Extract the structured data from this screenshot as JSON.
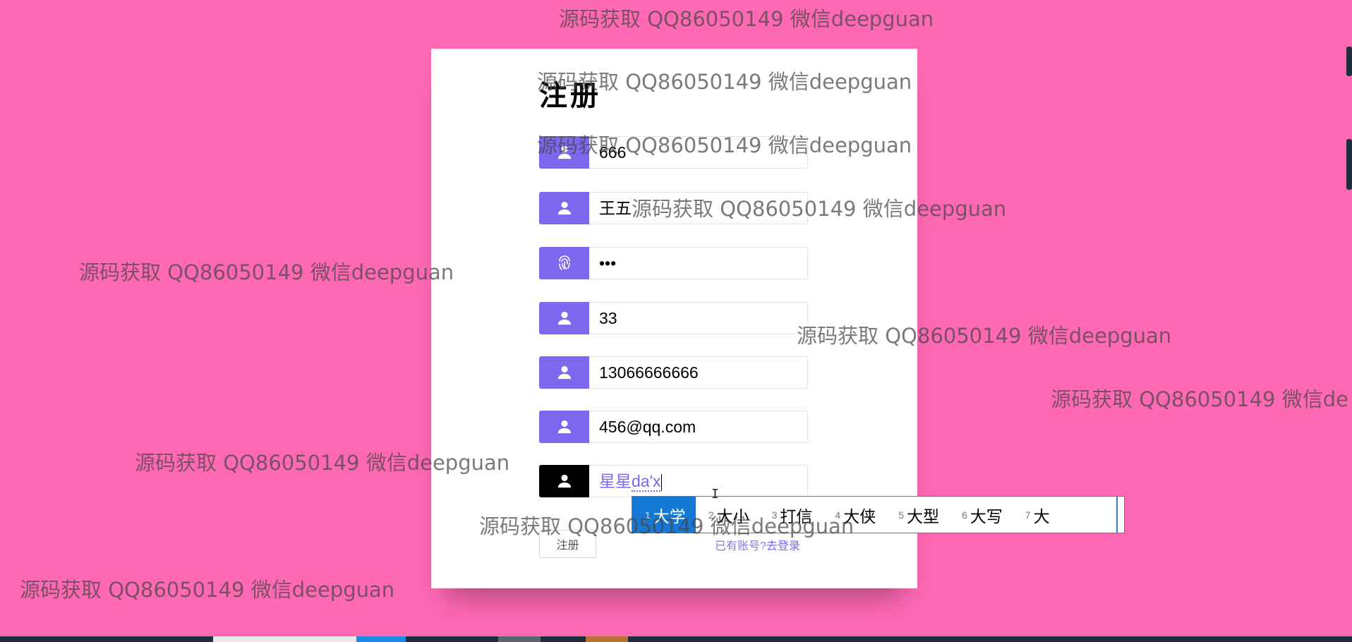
{
  "form": {
    "title": "注册",
    "fields": [
      {
        "value": "666",
        "icon": "user-icon"
      },
      {
        "value": "王五",
        "icon": "user-icon"
      },
      {
        "value": "•••",
        "icon": "fingerprint-icon"
      },
      {
        "value": "33",
        "icon": "user-icon"
      },
      {
        "value": "13066666666",
        "icon": "user-icon"
      },
      {
        "value": "456@qq.com",
        "icon": "user-icon"
      }
    ],
    "active_field": {
      "value": "星星",
      "composition": "da'x",
      "icon": "user-icon"
    },
    "register_button": "注册",
    "login_prompt": "已有账号?",
    "login_link": "去登录"
  },
  "ime": {
    "candidates": [
      {
        "num": "1",
        "text": "大学"
      },
      {
        "num": "2",
        "text": "大小"
      },
      {
        "num": "3",
        "text": "打信"
      },
      {
        "num": "4",
        "text": "大侠"
      },
      {
        "num": "5",
        "text": "大型"
      },
      {
        "num": "6",
        "text": "大写"
      },
      {
        "num": "7",
        "text": "大"
      }
    ]
  },
  "watermark": "源码获取 QQ86050149 微信deepguan",
  "watermark_partial": "源码获取 QQ86050149 微信de",
  "colors": {
    "background": "#ff69b4",
    "accent": "#7b68ee",
    "ime_selected": "#1478d4"
  }
}
